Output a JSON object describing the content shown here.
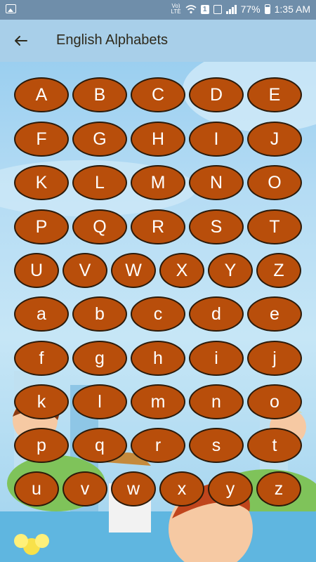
{
  "status_bar": {
    "left_icon": "image-icon",
    "network_label": "Vo) LTE",
    "sim_label": "1",
    "battery_percent": "77%",
    "time": "1:35 AM"
  },
  "app_bar": {
    "back_icon": "arrow-back-icon",
    "title": "English Alphabets"
  },
  "colors": {
    "button_fill": "#b84e0b",
    "button_border": "#2b1a0a",
    "app_bar": "#a8cfe9",
    "status_bar": "#6f8eaa"
  },
  "letters": {
    "uppercase": [
      "A",
      "B",
      "C",
      "D",
      "E",
      "F",
      "G",
      "H",
      "I",
      "J",
      "K",
      "L",
      "M",
      "N",
      "O",
      "P",
      "Q",
      "R",
      "S",
      "T",
      "U",
      "V",
      "W",
      "X",
      "Y",
      "Z"
    ],
    "lowercase": [
      "a",
      "b",
      "c",
      "d",
      "e",
      "f",
      "g",
      "h",
      "i",
      "j",
      "k",
      "l",
      "m",
      "n",
      "o",
      "p",
      "q",
      "r",
      "s",
      "t",
      "u",
      "v",
      "w",
      "x",
      "y",
      "z"
    ]
  }
}
